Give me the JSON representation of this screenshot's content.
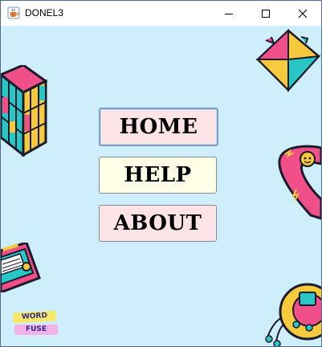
{
  "window": {
    "title": "DONEL3"
  },
  "menu": {
    "home_label": "HOME",
    "help_label": "HELP",
    "about_label": "ABOUT"
  },
  "logo": {
    "line1": "WORD",
    "line2": "FUSE"
  },
  "colors": {
    "background": "#cfeefc",
    "home_button": "#fbe3e6",
    "help_button": "#ffffe8",
    "about_button": "#fbe3e6",
    "focus_border": "#7b9bc9"
  },
  "icons": {
    "app": "java-coffee-icon",
    "decorations": [
      "rubiks-cube-icon",
      "paper-fortune-teller-icon",
      "telephone-handset-icon",
      "cassette-tape-icon",
      "discman-player-icon"
    ]
  }
}
